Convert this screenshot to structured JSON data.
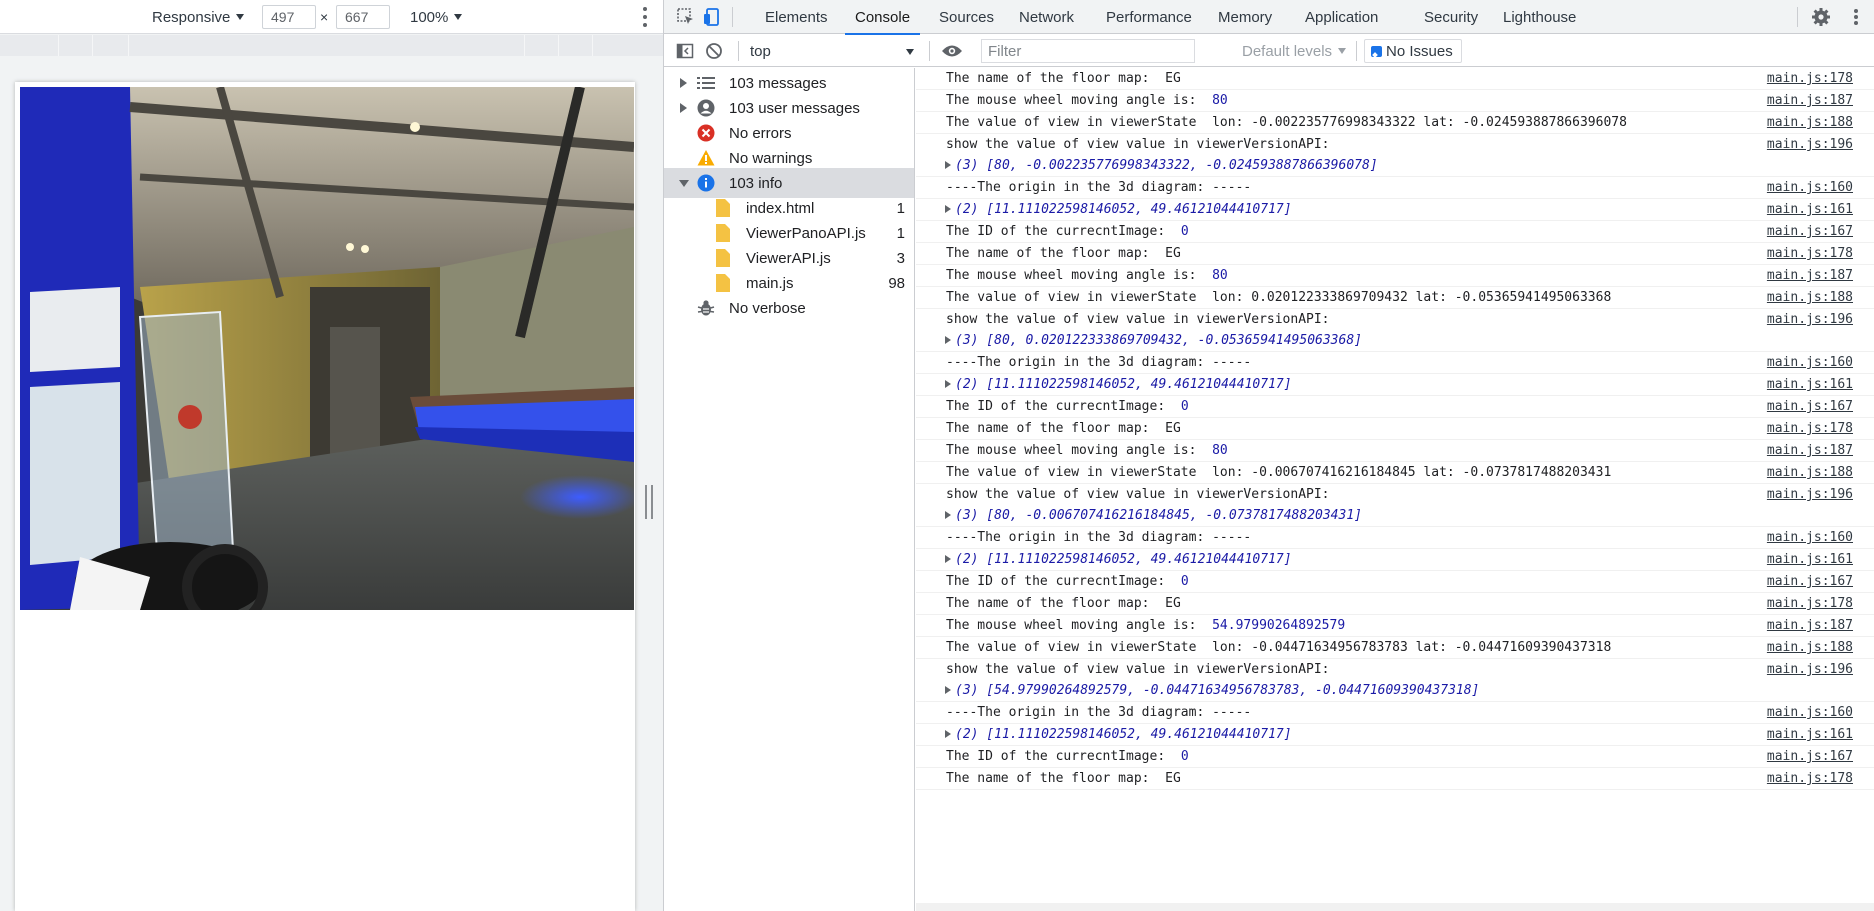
{
  "device_toolbar": {
    "device": "Responsive",
    "width": "497",
    "times": "×",
    "height": "667",
    "zoom": "100%"
  },
  "tabs": [
    "Elements",
    "Console",
    "Sources",
    "Network",
    "Performance",
    "Memory",
    "Application",
    "Security",
    "Lighthouse"
  ],
  "active_tab": "Console",
  "filterbar": {
    "context": "top",
    "filter_placeholder": "Filter",
    "levels": "Default levels",
    "issues": "No Issues"
  },
  "sidebar": {
    "items": [
      {
        "label": "103 messages",
        "icon": "list-icon",
        "expander": "right"
      },
      {
        "label": "103 user messages",
        "icon": "user-icon",
        "expander": "right"
      },
      {
        "label": "No errors",
        "icon": "error-icon",
        "expander": ""
      },
      {
        "label": "No warnings",
        "icon": "warning-icon",
        "expander": ""
      },
      {
        "label": "103 info",
        "icon": "info-icon",
        "expander": "down",
        "selected": true
      }
    ],
    "files": [
      {
        "name": "index.html",
        "count": "1"
      },
      {
        "name": "ViewerPanoAPI.js",
        "count": "1"
      },
      {
        "name": "ViewerAPI.js",
        "count": "3"
      },
      {
        "name": "main.js",
        "count": "98"
      }
    ],
    "verbose": "No verbose"
  },
  "console_messages": [
    {
      "text": "The name of the floor map:  EG",
      "source": "main.js:178"
    },
    {
      "text": "The mouse wheel moving angle is:  ",
      "value": "80",
      "source": "main.js:187"
    },
    {
      "text": "The value of view in viewerState  lon: -0.002235776998343322 lat: -0.024593887866396078",
      "source": "main.js:188"
    },
    {
      "text": "show the value of view value in viewerVersionAPI:",
      "array": "(3) [80, -0.002235776998343322, -0.024593887866396078]",
      "source": "main.js:196"
    },
    {
      "text": "----The origin in the 3d diagram: -----",
      "source": "main.js:160"
    },
    {
      "array": "(2) [11.111022598146052, 49.46121044410717]",
      "source": "main.js:161"
    },
    {
      "text": "The ID of the currecntImage:  ",
      "value": "0",
      "source": "main.js:167"
    },
    {
      "text": "The name of the floor map:  EG",
      "source": "main.js:178"
    },
    {
      "text": "The mouse wheel moving angle is:  ",
      "value": "80",
      "source": "main.js:187"
    },
    {
      "text": "The value of view in viewerState  lon: 0.020122333869709432 lat: -0.05365941495063368",
      "source": "main.js:188"
    },
    {
      "text": "show the value of view value in viewerVersionAPI:",
      "array": "(3) [80, 0.020122333869709432, -0.05365941495063368]",
      "source": "main.js:196"
    },
    {
      "text": "----The origin in the 3d diagram: -----",
      "source": "main.js:160"
    },
    {
      "array": "(2) [11.111022598146052, 49.46121044410717]",
      "source": "main.js:161"
    },
    {
      "text": "The ID of the currecntImage:  ",
      "value": "0",
      "source": "main.js:167"
    },
    {
      "text": "The name of the floor map:  EG",
      "source": "main.js:178"
    },
    {
      "text": "The mouse wheel moving angle is:  ",
      "value": "80",
      "source": "main.js:187"
    },
    {
      "text": "The value of view in viewerState  lon: -0.006707416216184845 lat: -0.0737817488203431",
      "source": "main.js:188"
    },
    {
      "text": "show the value of view value in viewerVersionAPI:",
      "array": "(3) [80, -0.006707416216184845, -0.0737817488203431]",
      "source": "main.js:196"
    },
    {
      "text": "----The origin in the 3d diagram: -----",
      "source": "main.js:160"
    },
    {
      "array": "(2) [11.111022598146052, 49.46121044410717]",
      "source": "main.js:161"
    },
    {
      "text": "The ID of the currecntImage:  ",
      "value": "0",
      "source": "main.js:167"
    },
    {
      "text": "The name of the floor map:  EG",
      "source": "main.js:178"
    },
    {
      "text": "The mouse wheel moving angle is:  ",
      "value": "54.97990264892579",
      "source": "main.js:187"
    },
    {
      "text": "The value of view in viewerState  lon: -0.04471634956783783 lat: -0.04471609390437318",
      "source": "main.js:188"
    },
    {
      "text": "show the value of view value in viewerVersionAPI:",
      "array": "(3) [54.97990264892579, -0.04471634956783783, -0.04471609390437318]",
      "source": "main.js:196"
    },
    {
      "text": "----The origin in the 3d diagram: -----",
      "source": "main.js:160"
    },
    {
      "array": "(2) [11.111022598146052, 49.46121044410717]",
      "source": "main.js:161"
    },
    {
      "text": "The ID of the currecntImage:  ",
      "value": "0",
      "source": "main.js:167"
    },
    {
      "text": "The name of the floor map:  EG",
      "source": "main.js:178"
    }
  ],
  "colors": {
    "accent": "#1a73e8",
    "console_value": "#1a1aa6",
    "error": "#d93025",
    "warning": "#f9ab00",
    "info": "#1a73e8",
    "file": "#f4c243"
  }
}
